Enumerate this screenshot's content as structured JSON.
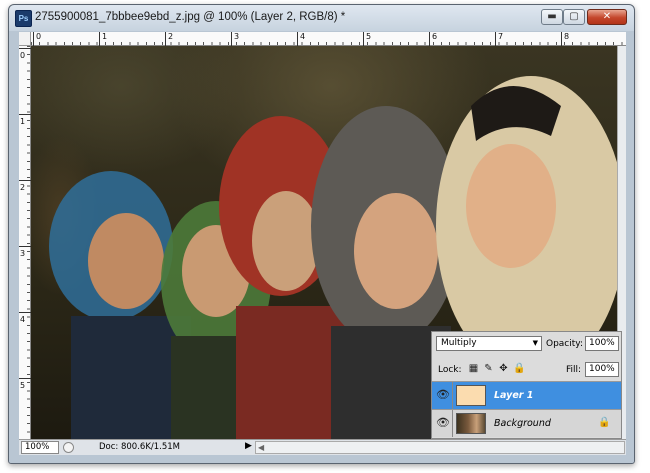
{
  "window": {
    "title": "2755900081_7bbbee9ebd_z.jpg @ 100% (Layer 2, RGB/8) *",
    "app_icon": "Ps",
    "controls": {
      "minimize": "▬",
      "maximize": "▢",
      "close": "✕"
    }
  },
  "rulers": {
    "horizontal": [
      "0",
      "1",
      "2",
      "3",
      "4",
      "5",
      "6",
      "7",
      "8"
    ],
    "vertical": [
      "0",
      "1",
      "2",
      "3",
      "4",
      "5"
    ]
  },
  "canvas": {
    "image_description_icon": "photo-canvas"
  },
  "status_bar": {
    "zoom": "100%",
    "doc_info": "Doc: 800.6K/1.51M",
    "arrow": "▶",
    "scroll_left": "◀"
  },
  "layers_panel": {
    "blend_mode": "Multiply",
    "opacity_label": "Opacity:",
    "opacity_value": "100%",
    "lock_label": "Lock:",
    "fill_label": "Fill:",
    "fill_value": "100%",
    "layers": [
      {
        "name": "Layer 1",
        "selected": true,
        "thumbnail_color": "#fbdcaf"
      },
      {
        "name": "Background",
        "selected": false,
        "locked": true
      }
    ]
  },
  "colors": {
    "selection": "#3f8fe0",
    "close_button": "#c4462b"
  }
}
